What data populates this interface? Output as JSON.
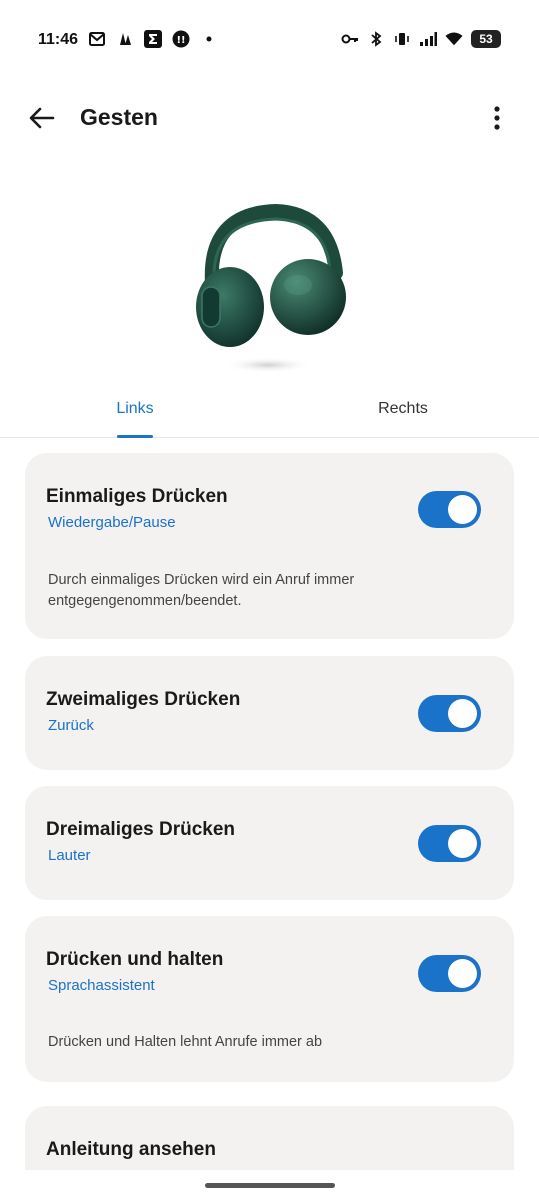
{
  "status_bar": {
    "time": "11:46",
    "battery": "53",
    "left_icons": [
      "mail-icon",
      "app-icon",
      "sigma-app-icon",
      "notification-app-icon",
      "dot-icon"
    ],
    "right_icons": [
      "key-icon",
      "bluetooth-icon",
      "vibrate-icon",
      "signal-icon",
      "wifi-icon"
    ]
  },
  "app_bar": {
    "title": "Gesten",
    "back_icon": "arrow-left-icon",
    "more_icon": "more-vert-icon"
  },
  "tabs": [
    {
      "label": "Links",
      "selected": true
    },
    {
      "label": "Rechts",
      "selected": false
    }
  ],
  "gestures": [
    {
      "title": "Einmaliges Drücken",
      "action": "Wiedergabe/Pause",
      "enabled": true,
      "description": "Durch einmaliges Drücken wird ein Anruf immer entgegengenommen/beendet."
    },
    {
      "title": "Zweimaliges Drücken",
      "action": "Zurück",
      "enabled": true,
      "description": ""
    },
    {
      "title": "Dreimaliges Drücken",
      "action": "Lauter",
      "enabled": true,
      "description": ""
    },
    {
      "title": "Drücken und halten",
      "action": "Sprachassistent",
      "enabled": true,
      "description": "Drücken und Halten lehnt Anrufe immer ab"
    }
  ],
  "guide": {
    "title": "Anleitung ansehen"
  },
  "colors": {
    "accent": "#1a73c9",
    "card_bg": "#f3f2f0",
    "headphone": "#1e4a3c"
  }
}
